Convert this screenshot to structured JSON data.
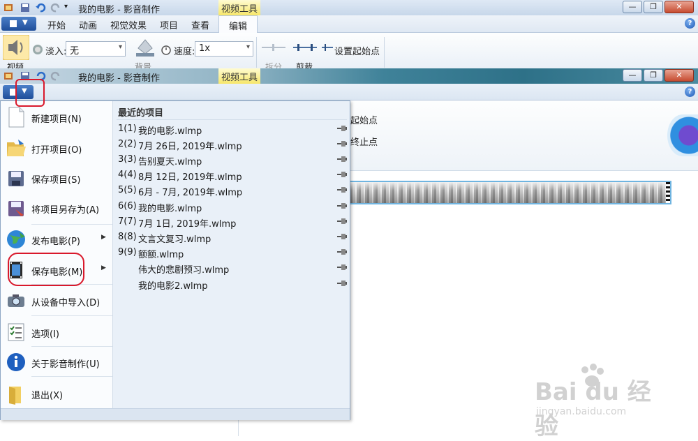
{
  "app": {
    "window_title": "我的电影 - 影音制作",
    "context_tab": "视频工具"
  },
  "menubar": {
    "tabs": [
      "开始",
      "动画",
      "视觉效果",
      "项目",
      "查看",
      "编辑"
    ],
    "active_tab": "编辑"
  },
  "ribbon": {
    "video_label": "视频",
    "fade_in_label": "淡入:",
    "fade_in_value": "无",
    "speed_label": "速度:",
    "speed_value": "1x",
    "background_label": "背景",
    "split_label": "拆分",
    "trim_label": "剪裁",
    "set_start_label": "设置起始点",
    "start_partial": "起始点",
    "end_partial": "终止点"
  },
  "file_menu": {
    "items": [
      {
        "label": "新建项目(N)",
        "icon": "new-doc-icon"
      },
      {
        "label": "打开项目(O)",
        "icon": "open-folder-icon"
      },
      {
        "label": "保存项目(S)",
        "icon": "save-disk-icon"
      },
      {
        "label": "将项目另存为(A)",
        "icon": "save-as-icon"
      },
      {
        "label": "发布电影(P)",
        "icon": "globe-publish-icon",
        "has_submenu": true
      },
      {
        "label": "保存电影(M)",
        "icon": "film-save-icon",
        "has_submenu": true
      },
      {
        "label": "从设备中导入(D)",
        "icon": "camera-import-icon"
      },
      {
        "label": "选项(I)",
        "icon": "checklist-icon"
      },
      {
        "label": "关于影音制作(U)",
        "icon": "info-icon"
      },
      {
        "label": "退出(X)",
        "icon": "exit-folder-icon"
      }
    ],
    "recent_title": "最近的项目",
    "recent": [
      {
        "num": "1(1)",
        "name": "我的电影.wlmp"
      },
      {
        "num": "2(2)",
        "name": "7月 26日, 2019年.wlmp"
      },
      {
        "num": "3(3)",
        "name": "告别夏天.wlmp"
      },
      {
        "num": "4(4)",
        "name": "8月 12日, 2019年.wlmp"
      },
      {
        "num": "5(5)",
        "name": "6月 - 7月, 2019年.wlmp"
      },
      {
        "num": "6(6)",
        "name": "我的电影.wlmp"
      },
      {
        "num": "7(7)",
        "name": "7月 1日, 2019年.wlmp"
      },
      {
        "num": "8(8)",
        "name": "文言文复习.wlmp"
      },
      {
        "num": "9(9)",
        "name": "额额.wlmp"
      },
      {
        "num": "",
        "name": "伟大的悲剧预习.wlmp"
      },
      {
        "num": "",
        "name": "我的电影2.wlmp"
      }
    ]
  },
  "watermark": {
    "brand": "Bai du 经验",
    "url": "jingyan.baidu.com"
  },
  "colors": {
    "highlight_red": "#d9182b",
    "file_button_blue": "#1f4e9a",
    "context_tab_yellow": "#f7e76a"
  }
}
